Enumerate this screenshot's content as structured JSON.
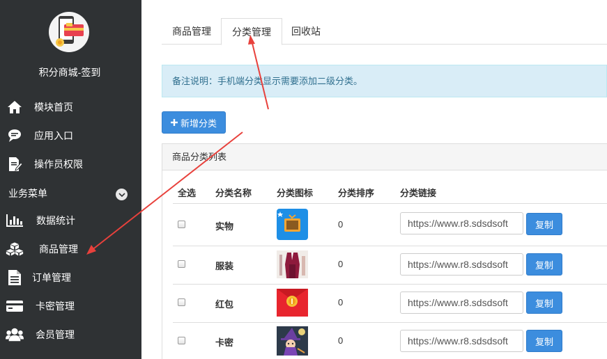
{
  "sidebar": {
    "app_title": "积分商城-签到",
    "nav_top": [
      {
        "label": "模块首页",
        "icon": "home-icon"
      },
      {
        "label": "应用入口",
        "icon": "chat-bubble-icon"
      },
      {
        "label": "操作员权限",
        "icon": "edit-document-icon"
      }
    ],
    "section_title": "业务菜单",
    "section_toggle_icon": "chevron-down-icon",
    "nav_business": [
      {
        "label": "数据统计",
        "icon": "bar-chart-icon"
      },
      {
        "label": "商品管理",
        "icon": "cubes-icon"
      },
      {
        "label": "订单管理",
        "icon": "document-icon"
      },
      {
        "label": "卡密管理",
        "icon": "credit-card-icon"
      },
      {
        "label": "会员管理",
        "icon": "users-icon"
      }
    ]
  },
  "tabs": [
    {
      "label": "商品管理",
      "active": false
    },
    {
      "label": "分类管理",
      "active": true
    },
    {
      "label": "回收站",
      "active": false
    }
  ],
  "notice": "备注说明：手机端分类显示需要添加二级分类。",
  "add_button": {
    "icon": "plus-icon",
    "label": "新增分类"
  },
  "panel_title": "商品分类列表",
  "table": {
    "headers": [
      "全选",
      "分类名称",
      "分类图标",
      "分类排序",
      "分类链接"
    ],
    "rows": [
      {
        "name": "实物",
        "icon": "tv-box-image",
        "sort": "0",
        "link": "https://www.r8.sdsdsoft",
        "copy": "复制"
      },
      {
        "name": "服装",
        "icon": "clothing-image",
        "sort": "0",
        "link": "https://www.r8.sdsdsoft",
        "copy": "复制"
      },
      {
        "name": "红包",
        "icon": "red-envelope-image",
        "sort": "0",
        "link": "https://www.r8.sdsdsoft",
        "copy": "复制"
      },
      {
        "name": "卡密",
        "icon": "cartoon-witch-image",
        "sort": "0",
        "link": "https://www.r8.sdsdsoft",
        "copy": "复制"
      }
    ]
  },
  "colors": {
    "sidebar_bg": "#2f3234",
    "primary": "#3c8dde",
    "notice_bg": "#d9edf7",
    "notice_text": "#31708f",
    "annotation_arrow": "#e8413c"
  }
}
